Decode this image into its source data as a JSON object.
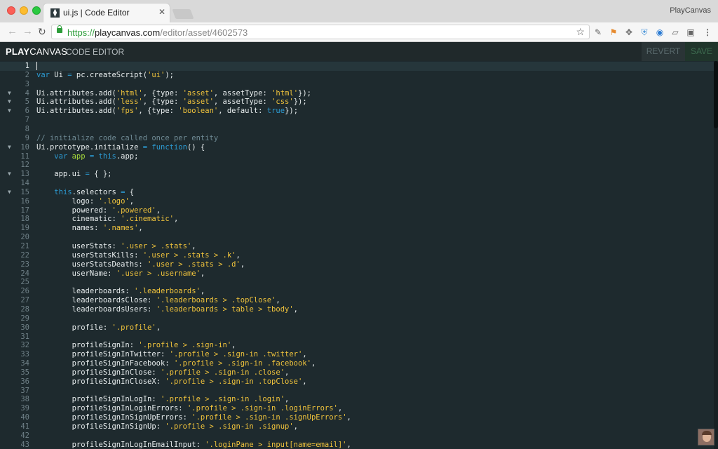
{
  "browser": {
    "tab_title": "ui.js | Code Editor",
    "tab_favicon": "playcanvas-favicon",
    "tab_close": "✕",
    "profile_name": "PlayCanvas",
    "url_proto": "https://",
    "url_host": "playcanvas.com",
    "url_path": "/editor/asset/4602573",
    "nav_back": "←",
    "nav_forward": "→",
    "nav_reload": "↻",
    "star": "☆"
  },
  "app": {
    "logo_bold": "PLAY",
    "logo_light": "CANVAS",
    "subtitle": "CODE EDITOR",
    "revert_label": "REVERT",
    "save_label": "SAVE"
  },
  "editor": {
    "active_line": 1,
    "lines": [
      {
        "n": "1",
        "fold": false,
        "tokens": []
      },
      {
        "n": "2",
        "fold": false,
        "tokens": [
          [
            "k",
            "var"
          ],
          [
            "p",
            " Ui "
          ],
          [
            "k",
            "="
          ],
          [
            "p",
            " pc.createScript("
          ],
          [
            "s",
            "'ui'"
          ],
          [
            "p",
            ");"
          ]
        ]
      },
      {
        "n": "3",
        "fold": false,
        "tokens": []
      },
      {
        "n": "4",
        "fold": true,
        "tokens": [
          [
            "p",
            "Ui.attributes.add("
          ],
          [
            "s",
            "'html'"
          ],
          [
            "p",
            ", {type: "
          ],
          [
            "s",
            "'asset'"
          ],
          [
            "p",
            ", assetType: "
          ],
          [
            "s",
            "'html'"
          ],
          [
            "p",
            "});"
          ]
        ]
      },
      {
        "n": "5",
        "fold": true,
        "tokens": [
          [
            "p",
            "Ui.attributes.add("
          ],
          [
            "s",
            "'less'"
          ],
          [
            "p",
            ", {type: "
          ],
          [
            "s",
            "'asset'"
          ],
          [
            "p",
            ", assetType: "
          ],
          [
            "s",
            "'css'"
          ],
          [
            "p",
            "});"
          ]
        ]
      },
      {
        "n": "6",
        "fold": true,
        "tokens": [
          [
            "p",
            "Ui.attributes.add("
          ],
          [
            "s",
            "'fps'"
          ],
          [
            "p",
            ", {type: "
          ],
          [
            "s",
            "'boolean'"
          ],
          [
            "p",
            ", default: "
          ],
          [
            "k",
            "true"
          ],
          [
            "p",
            "});"
          ]
        ]
      },
      {
        "n": "7",
        "fold": false,
        "tokens": []
      },
      {
        "n": "8",
        "fold": false,
        "tokens": []
      },
      {
        "n": "9",
        "fold": false,
        "tokens": [
          [
            "c",
            "// initialize code called once per entity"
          ]
        ]
      },
      {
        "n": "10",
        "fold": true,
        "tokens": [
          [
            "p",
            "Ui.prototype.initialize "
          ],
          [
            "k",
            "="
          ],
          [
            "p",
            " "
          ],
          [
            "k",
            "function"
          ],
          [
            "p",
            "() {"
          ]
        ]
      },
      {
        "n": "11",
        "fold": false,
        "tokens": [
          [
            "p",
            "    "
          ],
          [
            "k",
            "var"
          ],
          [
            "p",
            " "
          ],
          [
            "v",
            "app"
          ],
          [
            "p",
            " "
          ],
          [
            "k",
            "="
          ],
          [
            "p",
            " "
          ],
          [
            "k",
            "this"
          ],
          [
            "p",
            ".app;"
          ]
        ]
      },
      {
        "n": "12",
        "fold": false,
        "tokens": []
      },
      {
        "n": "13",
        "fold": true,
        "tokens": [
          [
            "p",
            "    app.ui "
          ],
          [
            "k",
            "="
          ],
          [
            "p",
            " { };"
          ]
        ]
      },
      {
        "n": "14",
        "fold": false,
        "tokens": []
      },
      {
        "n": "15",
        "fold": true,
        "tokens": [
          [
            "p",
            "    "
          ],
          [
            "k",
            "this"
          ],
          [
            "p",
            ".selectors "
          ],
          [
            "k",
            "="
          ],
          [
            "p",
            " {"
          ]
        ]
      },
      {
        "n": "16",
        "fold": false,
        "tokens": [
          [
            "p",
            "        logo: "
          ],
          [
            "s",
            "'.logo'"
          ],
          [
            "p",
            ","
          ]
        ]
      },
      {
        "n": "17",
        "fold": false,
        "tokens": [
          [
            "p",
            "        powered: "
          ],
          [
            "s",
            "'.powered'"
          ],
          [
            "p",
            ","
          ]
        ]
      },
      {
        "n": "18",
        "fold": false,
        "tokens": [
          [
            "p",
            "        cinematic: "
          ],
          [
            "s",
            "'.cinematic'"
          ],
          [
            "p",
            ","
          ]
        ]
      },
      {
        "n": "19",
        "fold": false,
        "tokens": [
          [
            "p",
            "        names: "
          ],
          [
            "s",
            "'.names'"
          ],
          [
            "p",
            ","
          ]
        ]
      },
      {
        "n": "20",
        "fold": false,
        "tokens": []
      },
      {
        "n": "21",
        "fold": false,
        "tokens": [
          [
            "p",
            "        userStats: "
          ],
          [
            "s",
            "'.user > .stats'"
          ],
          [
            "p",
            ","
          ]
        ]
      },
      {
        "n": "22",
        "fold": false,
        "tokens": [
          [
            "p",
            "        userStatsKills: "
          ],
          [
            "s",
            "'.user > .stats > .k'"
          ],
          [
            "p",
            ","
          ]
        ]
      },
      {
        "n": "23",
        "fold": false,
        "tokens": [
          [
            "p",
            "        userStatsDeaths: "
          ],
          [
            "s",
            "'.user > .stats > .d'"
          ],
          [
            "p",
            ","
          ]
        ]
      },
      {
        "n": "24",
        "fold": false,
        "tokens": [
          [
            "p",
            "        userName: "
          ],
          [
            "s",
            "'.user > .username'"
          ],
          [
            "p",
            ","
          ]
        ]
      },
      {
        "n": "25",
        "fold": false,
        "tokens": []
      },
      {
        "n": "26",
        "fold": false,
        "tokens": [
          [
            "p",
            "        leaderboards: "
          ],
          [
            "s",
            "'.leaderboards'"
          ],
          [
            "p",
            ","
          ]
        ]
      },
      {
        "n": "27",
        "fold": false,
        "tokens": [
          [
            "p",
            "        leaderboardsClose: "
          ],
          [
            "s",
            "'.leaderboards > .topClose'"
          ],
          [
            "p",
            ","
          ]
        ]
      },
      {
        "n": "28",
        "fold": false,
        "tokens": [
          [
            "p",
            "        leaderboardsUsers: "
          ],
          [
            "s",
            "'.leaderboards > table > tbody'"
          ],
          [
            "p",
            ","
          ]
        ]
      },
      {
        "n": "29",
        "fold": false,
        "tokens": []
      },
      {
        "n": "30",
        "fold": false,
        "tokens": [
          [
            "p",
            "        profile: "
          ],
          [
            "s",
            "'.profile'"
          ],
          [
            "p",
            ","
          ]
        ]
      },
      {
        "n": "31",
        "fold": false,
        "tokens": []
      },
      {
        "n": "32",
        "fold": false,
        "tokens": [
          [
            "p",
            "        profileSignIn: "
          ],
          [
            "s",
            "'.profile > .sign-in'"
          ],
          [
            "p",
            ","
          ]
        ]
      },
      {
        "n": "33",
        "fold": false,
        "tokens": [
          [
            "p",
            "        profileSignInTwitter: "
          ],
          [
            "s",
            "'.profile > .sign-in .twitter'"
          ],
          [
            "p",
            ","
          ]
        ]
      },
      {
        "n": "34",
        "fold": false,
        "tokens": [
          [
            "p",
            "        profileSignInFacebook: "
          ],
          [
            "s",
            "'.profile > .sign-in .facebook'"
          ],
          [
            "p",
            ","
          ]
        ]
      },
      {
        "n": "35",
        "fold": false,
        "tokens": [
          [
            "p",
            "        profileSignInClose: "
          ],
          [
            "s",
            "'.profile > .sign-in .close'"
          ],
          [
            "p",
            ","
          ]
        ]
      },
      {
        "n": "36",
        "fold": false,
        "tokens": [
          [
            "p",
            "        profileSignInCloseX: "
          ],
          [
            "s",
            "'.profile > .sign-in .topClose'"
          ],
          [
            "p",
            ","
          ]
        ]
      },
      {
        "n": "37",
        "fold": false,
        "tokens": []
      },
      {
        "n": "38",
        "fold": false,
        "tokens": [
          [
            "p",
            "        profileSignInLogIn: "
          ],
          [
            "s",
            "'.profile > .sign-in .login'"
          ],
          [
            "p",
            ","
          ]
        ]
      },
      {
        "n": "39",
        "fold": false,
        "tokens": [
          [
            "p",
            "        profileSignInLoginErrors: "
          ],
          [
            "s",
            "'.profile > .sign-in .loginErrors'"
          ],
          [
            "p",
            ","
          ]
        ]
      },
      {
        "n": "40",
        "fold": false,
        "tokens": [
          [
            "p",
            "        profileSignInSignUpErrors: "
          ],
          [
            "s",
            "'.profile > .sign-in .signUpErrors'"
          ],
          [
            "p",
            ","
          ]
        ]
      },
      {
        "n": "41",
        "fold": false,
        "tokens": [
          [
            "p",
            "        profileSignInSignUp: "
          ],
          [
            "s",
            "'.profile > .sign-in .signup'"
          ],
          [
            "p",
            ","
          ]
        ]
      },
      {
        "n": "42",
        "fold": false,
        "tokens": []
      },
      {
        "n": "43",
        "fold": false,
        "tokens": [
          [
            "p",
            "        profileSignInLogInEmailInput: "
          ],
          [
            "s",
            "'.loginPane > input[name=email]'"
          ],
          [
            "p",
            ","
          ]
        ]
      }
    ]
  },
  "colors": {
    "keyword": "#2c9bd3",
    "string": "#f0c33c",
    "comment": "#6f8a94",
    "variable": "#a6da3b",
    "text": "#e8edee",
    "background": "#1e2a2e"
  },
  "icons": [
    "lock-icon",
    "star-icon",
    "eyedropper-icon",
    "extension-icon",
    "move-icon",
    "shield-icon",
    "ghostery-icon",
    "translate-icon",
    "menu-icon"
  ]
}
